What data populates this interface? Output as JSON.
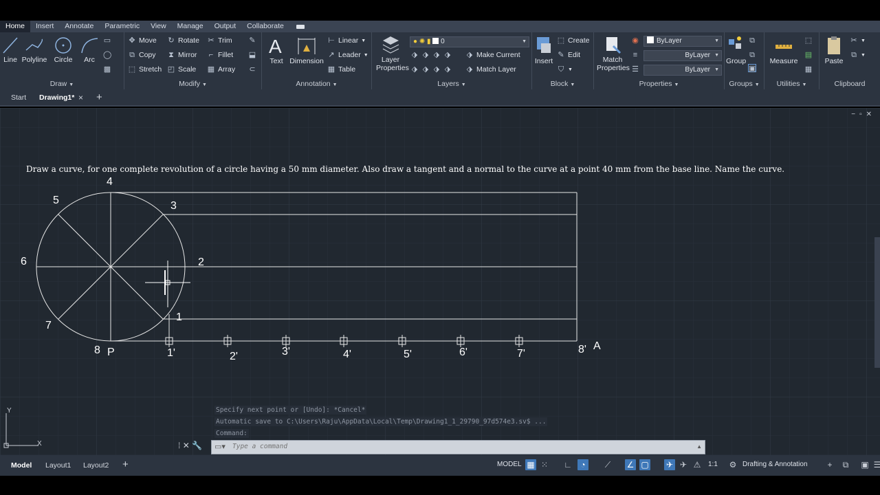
{
  "ribbon_tabs": [
    "Home",
    "Insert",
    "Annotate",
    "Parametric",
    "View",
    "Manage",
    "Output",
    "Collaborate"
  ],
  "draw_panel": {
    "title": "Draw",
    "tools": [
      "Line",
      "Polyline",
      "Circle",
      "Arc"
    ]
  },
  "modify_panel": {
    "title": "Modify",
    "tools": [
      "Move",
      "Rotate",
      "Trim",
      "Copy",
      "Mirror",
      "Fillet",
      "Stretch",
      "Scale",
      "Array"
    ]
  },
  "annotation_panel": {
    "title": "Annotation",
    "tools": [
      "Text",
      "Dimension",
      "Linear",
      "Leader",
      "Table"
    ]
  },
  "layers_panel": {
    "title": "Layers",
    "layer_properties": "Layer Properties",
    "current_layer": "0",
    "make_current": "Make Current",
    "match_layer": "Match Layer"
  },
  "block_panel": {
    "title": "Block",
    "insert": "Insert",
    "create": "Create",
    "edit": "Edit"
  },
  "properties_panel": {
    "title": "Properties",
    "match_properties": "Match Properties",
    "color": "ByLayer",
    "linetype": "ByLayer",
    "lineweight": "ByLayer"
  },
  "groups_panel": {
    "title": "Groups",
    "group": "Group"
  },
  "utilities_panel": {
    "title": "Utilities",
    "measure": "Measure"
  },
  "clipboard_panel": {
    "title": "Clipboard",
    "paste": "Paste"
  },
  "doc_tabs": {
    "start": "Start",
    "active": "Drawing1*",
    "close": "×",
    "add": "+"
  },
  "question": "Draw a curve, for one complete revolution of a circle having a 50 mm diameter. Also draw a tangent and a normal to the curve at a point 40 mm from the base line. Name the curve.",
  "circle_labels": {
    "p1": "1",
    "p2": "2",
    "p3": "3",
    "p4": "4",
    "p5": "5",
    "p6": "6",
    "p7": "7",
    "p8": "8",
    "p": "P"
  },
  "baseline_labels": [
    "1'",
    "2'",
    "3'",
    "4'",
    "5'",
    "6'",
    "7'",
    "8'"
  ],
  "end_label": "A",
  "command_history": [
    "Specify next point or [Undo]: *Cancel*",
    "Automatic save to C:\\Users\\Raju\\AppData\\Local\\Temp\\Drawing1_1_29790_97d574e3.sv$ ...",
    "Command:"
  ],
  "command_placeholder": "Type a command",
  "layout_tabs": [
    "Model",
    "Layout1",
    "Layout2"
  ],
  "status": {
    "model": "MODEL",
    "scale": "1:1",
    "workspace": "Drafting & Annotation"
  },
  "ucs": {
    "x": "X",
    "y": "Y"
  },
  "colors": {
    "canvas": "#212830",
    "ribbon": "#2c3440",
    "active_toggle": "#3f78b8"
  }
}
